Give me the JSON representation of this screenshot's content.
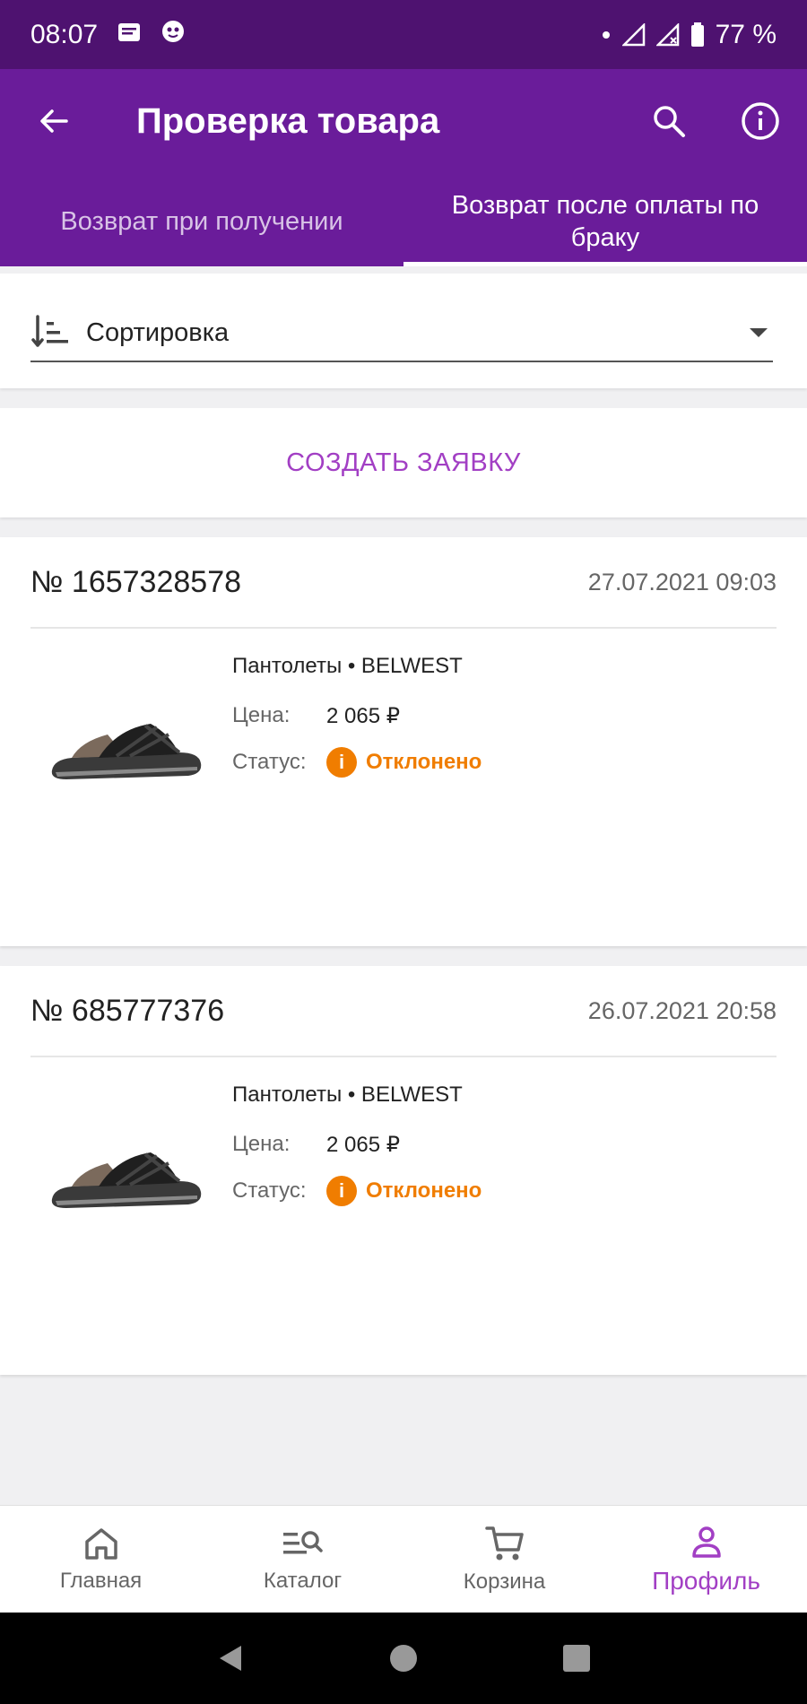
{
  "status_bar": {
    "time": "08:07",
    "battery": "77 %"
  },
  "app_bar": {
    "title": "Проверка товара"
  },
  "tabs": [
    {
      "label": "Возврат при получении",
      "active": false
    },
    {
      "label": "Возврат после оплаты по браку",
      "active": true
    }
  ],
  "sort": {
    "label": "Сортировка"
  },
  "create_button": {
    "label": "СОЗДАТЬ ЗАЯВКУ"
  },
  "requests": [
    {
      "number": "№ 1657328578",
      "date": "27.07.2021 09:03",
      "product": "Пантолеты • BELWEST",
      "price_label": "Цена:",
      "price": "2 065 ₽",
      "status_label": "Статус:",
      "status": "Отклонено"
    },
    {
      "number": "№ 685777376",
      "date": "26.07.2021 20:58",
      "product": "Пантолеты • BELWEST",
      "price_label": "Цена:",
      "price": "2 065 ₽",
      "status_label": "Статус:",
      "status": "Отклонено"
    }
  ],
  "bottom_nav": [
    {
      "label": "Главная",
      "icon": "home-icon"
    },
    {
      "label": "Каталог",
      "icon": "catalog-search-icon"
    },
    {
      "label": "Корзина",
      "icon": "cart-icon"
    },
    {
      "label": "Профиль",
      "icon": "profile-icon",
      "active": true
    }
  ],
  "colors": {
    "primary": "#6a1c9a",
    "status_bar": "#4e1270",
    "accent": "#a23fc4",
    "warning": "#f07d00"
  }
}
